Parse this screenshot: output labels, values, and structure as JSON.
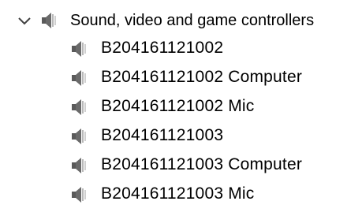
{
  "tree": {
    "category": {
      "label": "Sound, video and game controllers",
      "expanded": true,
      "icon": "speaker-icon",
      "toggle_icon": "chevron-down-icon"
    },
    "devices": [
      {
        "label": "B204161121002",
        "icon": "speaker-icon"
      },
      {
        "label": "B204161121002 Computer",
        "icon": "speaker-icon"
      },
      {
        "label": "B204161121002 Mic",
        "icon": "speaker-icon"
      },
      {
        "label": "B204161121003",
        "icon": "speaker-icon"
      },
      {
        "label": "B204161121003 Computer",
        "icon": "speaker-icon"
      },
      {
        "label": "B204161121003 Mic",
        "icon": "speaker-icon"
      }
    ]
  },
  "colors": {
    "icon_dark": "#5a5a5a",
    "icon_light": "#b8b8b8",
    "chevron": "#404040",
    "text": "#000000"
  }
}
